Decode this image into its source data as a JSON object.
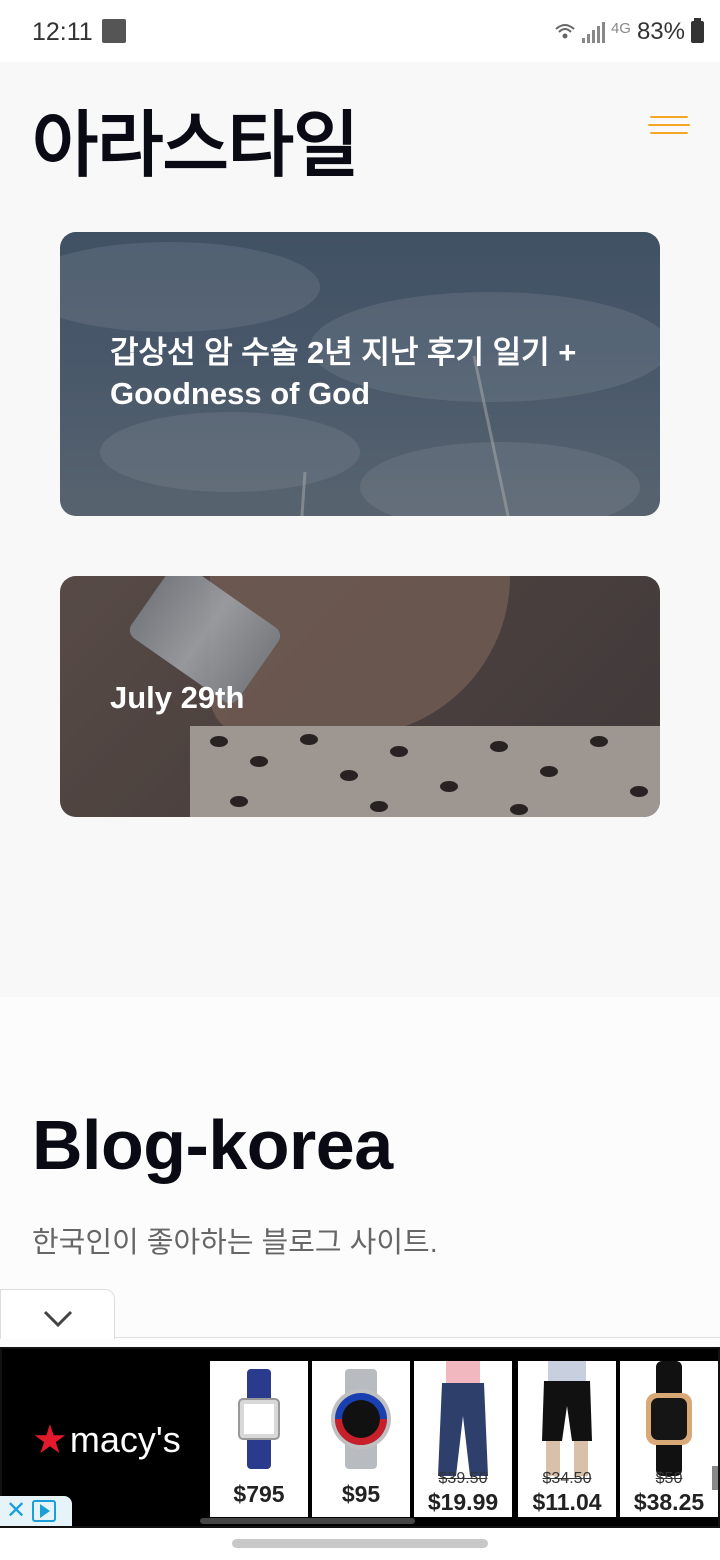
{
  "status_bar": {
    "time": "12:11",
    "network": "4G",
    "battery": "83%"
  },
  "header": {
    "site_title": "아라스타일",
    "menu_icon": "hamburger-menu-icon",
    "accent_color": "#f5a623"
  },
  "posts": [
    {
      "title": "갑상선 암 수술 2년 지난 후기 일기 + Goodness of God"
    },
    {
      "title": "July 29th"
    }
  ],
  "blog_section": {
    "heading": "Blog-korea",
    "description": "한국인이 좋아하는 블로그 사이트."
  },
  "ad": {
    "brand": "macy's",
    "brand_color": "#e21a2c",
    "products": [
      {
        "name_icon": "wristwatch-blue-strap",
        "price": "$795",
        "old_price": ""
      },
      {
        "name_icon": "wristwatch-steel-bracelet",
        "price": "$95",
        "old_price": ""
      },
      {
        "name_icon": "jeans",
        "price": "$19.99",
        "old_price": "$39.50"
      },
      {
        "name_icon": "black-shorts",
        "price": "$11.04",
        "old_price": "$34.50"
      },
      {
        "name_icon": "smartwatch-black-strap",
        "price": "$38.25",
        "old_price": "$50"
      }
    ]
  }
}
